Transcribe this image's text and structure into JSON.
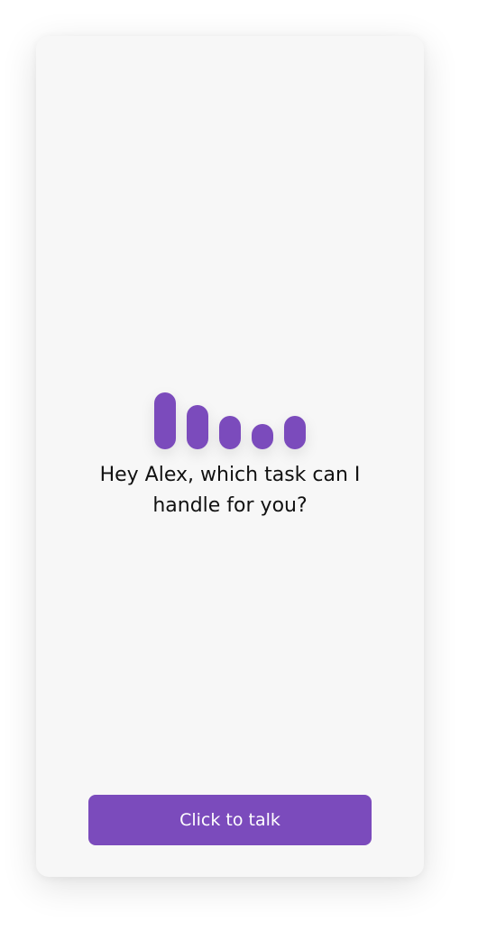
{
  "assistant": {
    "prompt_text": "Hey Alex, which task can I handle for you?",
    "talk_button_label": "Click to talk"
  },
  "colors": {
    "accent": "#7B4BBC",
    "card_background": "#f7f7f7",
    "text": "#111111"
  },
  "icons": {
    "voice_indicator": "audio-waveform-icon"
  },
  "voice_levels": [
    1.0,
    0.78,
    0.58,
    0.45,
    0.58
  ]
}
